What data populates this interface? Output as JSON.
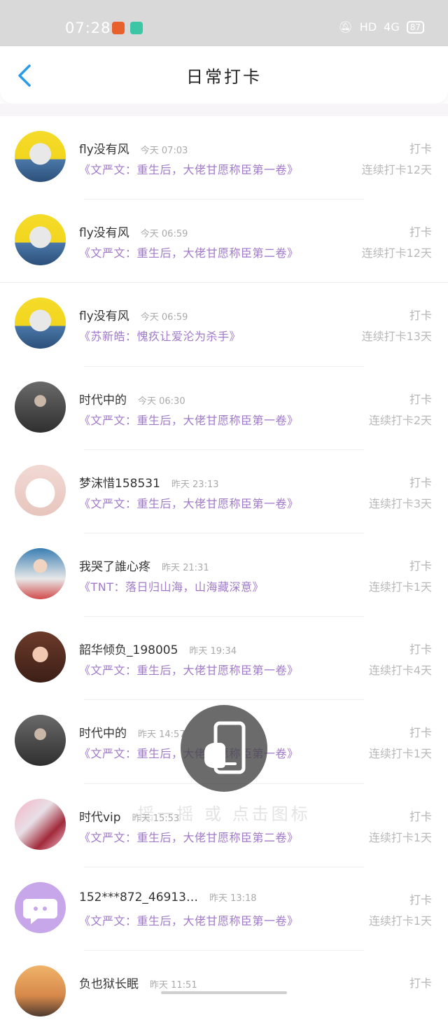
{
  "status_bar": {
    "time": "07:28",
    "network": "HD",
    "signal": "4G",
    "battery": "87"
  },
  "header": {
    "title": "日常打卡"
  },
  "list": [
    {
      "name": "fly没有风",
      "time": "今天 07:03",
      "action": "打卡",
      "book": "《文严文：重生后，大佬甘愿称臣第一卷》",
      "streak": "连续打卡12天",
      "avatar": "group-photo"
    },
    {
      "name": "fly没有风",
      "time": "今天 06:59",
      "action": "打卡",
      "book": "《文严文：重生后，大佬甘愿称臣第二卷》",
      "streak": "连续打卡12天",
      "avatar": "group-photo"
    },
    {
      "name": "fly没有风",
      "time": "今天 06:59",
      "action": "打卡",
      "book": "《苏新皓：愧疚让爱沦为杀手》",
      "streak": "连续打卡13天",
      "avatar": "group-photo"
    },
    {
      "name": "时代中的",
      "time": "今天 06:30",
      "action": "打卡",
      "book": "《文严文：重生后，大佬甘愿称臣第一卷》",
      "streak": "连续打卡2天",
      "avatar": "dark-portrait"
    },
    {
      "name": "梦沫惜158531",
      "time": "昨天 23:13",
      "action": "打卡",
      "book": "《文严文：重生后，大佬甘愿称臣第一卷》",
      "streak": "连续打卡3天",
      "avatar": "cat"
    },
    {
      "name": "我哭了誰心疼",
      "time": "昨天 21:31",
      "action": "打卡",
      "book": "《TNT：落日归山海，山海藏深意》",
      "streak": "连续打卡1天",
      "avatar": "boy-portrait"
    },
    {
      "name": "韶华倾负_198005",
      "time": "昨天 19:34",
      "action": "打卡",
      "book": "《文严文：重生后，大佬甘愿称臣第一卷》",
      "streak": "连续打卡4天",
      "avatar": "girl-portrait"
    },
    {
      "name": "时代中的",
      "time": "昨天 14:57",
      "action": "打卡",
      "book": "《文严文：重生后，大佬甘愿称臣第一卷》",
      "streak": "连续打卡1天",
      "avatar": "dark-portrait"
    },
    {
      "name": "时代vip",
      "time": "昨天 15:53",
      "action": "打卡",
      "book": "《文严文：重生后，大佬甘愿称臣第二卷》",
      "streak": "连续打卡1天",
      "avatar": "collage"
    },
    {
      "name": "152***872_46913…",
      "time": "昨天 13:18",
      "action": "打卡",
      "book": "《文严文：重生后，大佬甘愿称臣第一卷》",
      "streak": "连续打卡1天",
      "avatar": "default-chat"
    },
    {
      "name": "负也狱长眠",
      "time": "昨天 11:51",
      "action": "打卡",
      "book": "",
      "streak": "",
      "avatar": "sunset"
    }
  ],
  "overlay": {
    "tip": "摇一摇 或 点击图标"
  },
  "colors": {
    "accent": "#2a9bea",
    "book_title": "#a07ac8",
    "status_bar": "#d9d9d9"
  }
}
